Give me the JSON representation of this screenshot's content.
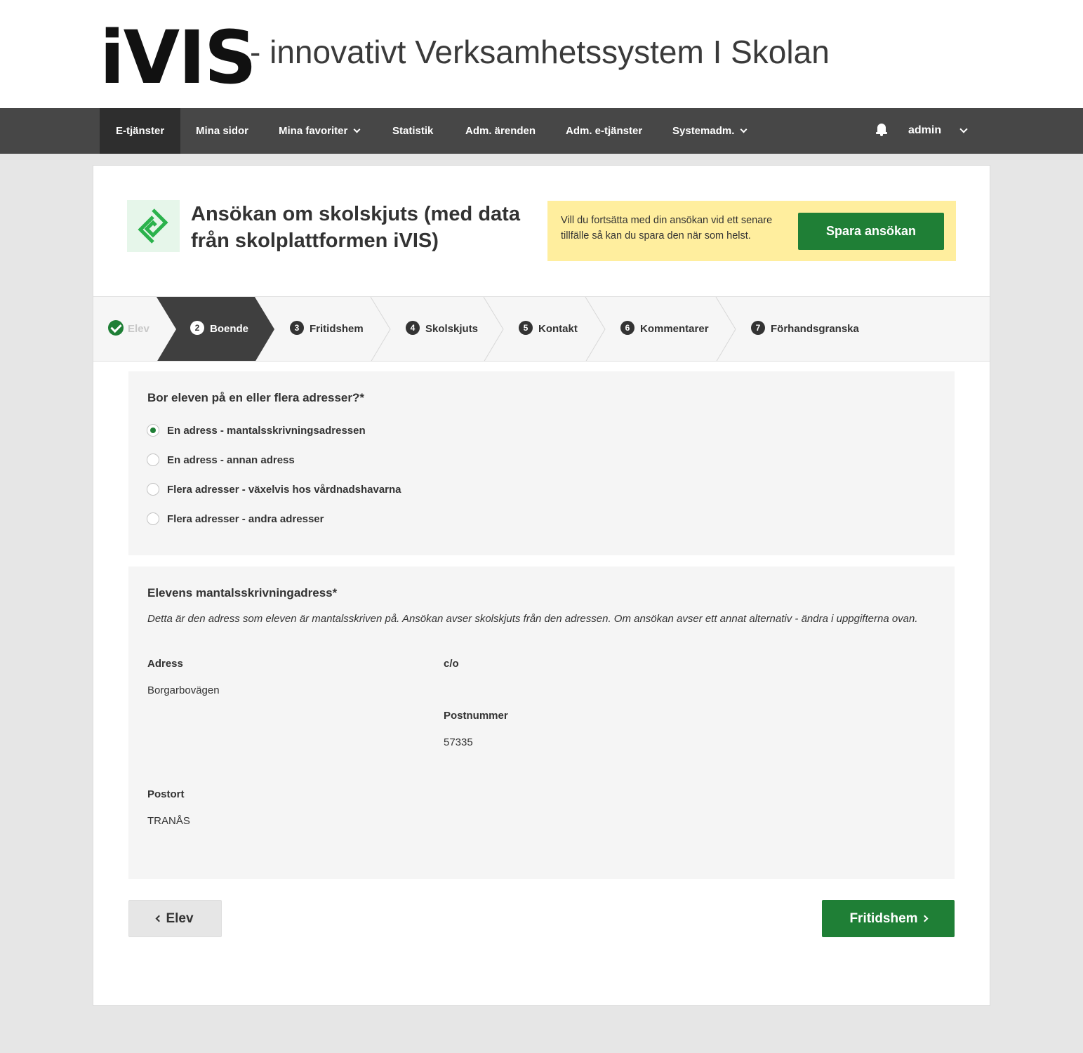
{
  "header": {
    "logo": "iVIS",
    "tagline": "- innovativt Verksamhetssystem I Skolan"
  },
  "nav": {
    "items": [
      {
        "label": "E-tjänster",
        "active": true
      },
      {
        "label": "Mina sidor"
      },
      {
        "label": "Mina favoriter",
        "dropdown": true
      },
      {
        "label": "Statistik"
      },
      {
        "label": "Adm. ärenden"
      },
      {
        "label": "Adm. e-tjänster"
      },
      {
        "label": "Systemadm.",
        "dropdown": true
      }
    ],
    "user": "admin",
    "notification_icon": "bell-icon"
  },
  "service": {
    "title": "Ansökan om skolskjuts (med data från skolplattformen iVIS)",
    "save_text": "Vill du fortsätta med din ansökan vid ett senare tillfälle så kan du spara den när som helst.",
    "save_button": "Spara ansökan"
  },
  "steps": [
    {
      "number": "",
      "label": "Elev",
      "state": "done"
    },
    {
      "number": "2",
      "label": "Boende",
      "state": "current"
    },
    {
      "number": "3",
      "label": "Fritidshem"
    },
    {
      "number": "4",
      "label": "Skolskjuts"
    },
    {
      "number": "5",
      "label": "Kontakt"
    },
    {
      "number": "6",
      "label": "Kommentarer"
    },
    {
      "number": "7",
      "label": "Förhandsgranska"
    }
  ],
  "question": {
    "title": "Bor eleven på en eller flera adresser?*",
    "options": [
      {
        "label": "En adress - mantalsskrivningsadressen",
        "checked": true
      },
      {
        "label": "En adress - annan adress",
        "checked": false
      },
      {
        "label": "Flera adresser - växelvis hos vårdnadshavarna",
        "checked": false
      },
      {
        "label": "Flera adresser - andra adresser",
        "checked": false
      }
    ]
  },
  "address": {
    "title": "Elevens mantalsskrivningadress*",
    "description": "Detta är den adress som eleven är mantalsskriven på. Ansökan avser skolskjuts från den adressen. Om ansökan avser ett annat alternativ - ändra i uppgifterna ovan.",
    "adress_label": "Adress",
    "adress_value": "Borgarbovägen",
    "co_label": "c/o",
    "co_value": "",
    "postnummer_label": "Postnummer",
    "postnummer_value": "57335",
    "postort_label": "Postort",
    "postort_value": "TRANÅS"
  },
  "navigation": {
    "prev_label": "Elev",
    "next_label": "Fritidshem"
  },
  "colors": {
    "brand_green": "#1f7f36",
    "navbar": "#474747",
    "notice_yellow": "#ffee9e"
  }
}
